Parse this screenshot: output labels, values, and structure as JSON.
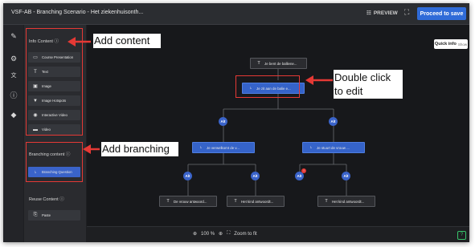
{
  "header": {
    "title": "VSF-AB - Branching Scenario - Het ziekenhuisonth...",
    "preview_label": "PREVIEW",
    "proceed_label": "Proceed to save"
  },
  "icon_rail": [
    "pencil-icon",
    "gear-icon",
    "translate-icon",
    "help-circle-icon",
    "tag-icon"
  ],
  "sidebar": {
    "info_title": "Info Content ⓘ",
    "info_items": [
      {
        "icon": "▭",
        "label": "Course Presentation"
      },
      {
        "icon": "T",
        "label": "Text"
      },
      {
        "icon": "▣",
        "label": "Image"
      },
      {
        "icon": "▼",
        "label": "Image Hotspots"
      },
      {
        "icon": "◉",
        "label": "Interactive Video"
      },
      {
        "icon": "▬",
        "label": "Video"
      }
    ],
    "branching_title": "Branching content ⓘ",
    "branching_items": [
      {
        "icon": "⭏",
        "label": "Branching Question"
      }
    ],
    "reuse_title": "Reuse Content ⓘ",
    "reuse_items": [
      {
        "icon": "⎘",
        "label": "Paste"
      }
    ]
  },
  "canvas": {
    "quick_info_label": "Quick info",
    "quick_info_show": "Show",
    "nodes": {
      "start": "Je bent de balliene...",
      "question": "Je zit aan de balie e...",
      "left_q": "Je verwelkomt de v...",
      "right_q": "Je stuurt de vrouw ...",
      "leaf1": "De vrouw antwoord...",
      "leaf2": "Het kind antwoordt...",
      "leaf3": "Het kind antwoordt..."
    },
    "alt_label": "Alt",
    "badge": "!"
  },
  "zoom": {
    "zoom_out_icon": "🔍",
    "level": "100 %",
    "zoom_to_fit": "Zoom to fit"
  },
  "annotations": {
    "add_content": "Add content",
    "double_click": "Double click\nto edit",
    "add_branching": "Add branching"
  },
  "colors": {
    "accent": "#2f6bd8",
    "highlight": "#e53935",
    "node_blue": "#3563c9"
  }
}
